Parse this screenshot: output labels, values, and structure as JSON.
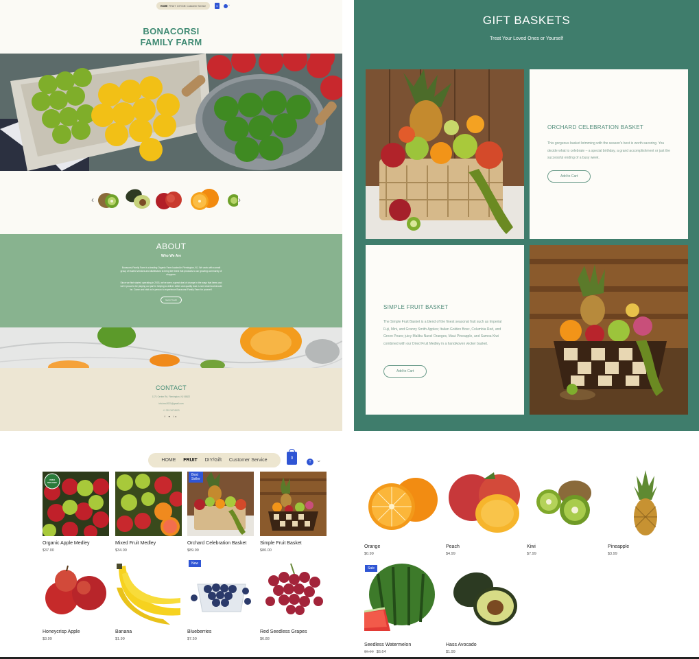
{
  "home": {
    "nav": {
      "items": [
        "HOME",
        "FRUIT",
        "DIY/Gift",
        "Customer Service"
      ],
      "active": "HOME"
    },
    "cart_count": "0",
    "brand_line1": "BONACORSI",
    "brand_line2": "FAMILY FARM",
    "about": {
      "title": "ABOUT",
      "subtitle": "Who We Are",
      "para1": "Bonacorsi Family Farm is a leading Organic Farm located in Flemington, NJ. We work with a small group of trusted vendors and distributors to bring the finest fruit products to our growing community of shoppers.",
      "para2": "Since we first started operating in 2003, we've seen a great deal of change in the ways that items and we're proud to be playing our part in helping to deliver better and quality food. Learn what food should be. Come and visit us in person to experience Bonacorsi Family Farm for yourself.",
      "button": "Get in Touch"
    },
    "contact": {
      "title": "CONTACT",
      "address": "1171 Center Rd, Flemington, NJ 08822",
      "email": "info.bnc2021@gmail.com",
      "phone": "+1 215 347 6913",
      "social": "f  ♥  in"
    }
  },
  "gifts": {
    "title": "GIFT BASKETS",
    "subtitle": "Treat Your Loved Ones or Yourself",
    "orchard": {
      "name": "ORCHARD CELEBRATION BASKET",
      "desc": "This gorgeous basket brimming with the season's best is worth savoring. You decide what to celebrate – a special birthday, a grand accomplishment or just the successful ending of a busy week.",
      "button": "Add to Cart"
    },
    "simple": {
      "name": "SIMPLE FRUIT BASKET",
      "desc": "The Simple Fruit Basket is a blend of the finest seasonal fruit such as Imperial Fuji, Mini, and Granny Smith Apples; Italian Golden Bosc, Columbia Red, and Green Pears; juicy Malibu Navel Oranges, Maui Pineapple, and Samoa Kiwi combined with our Dried Fruit Medley in a handwoven wicker basket.",
      "button": "Add to Cart"
    }
  },
  "shop": {
    "nav": {
      "items": [
        "HOME",
        "FRUIT",
        "DIY/Gift",
        "Customer Service"
      ],
      "active": "FRUIT"
    },
    "cart_count": "0",
    "avatar_letter": "T",
    "products": [
      {
        "name": "Organic Apple Medley",
        "price": "$37.00"
      },
      {
        "name": "Mixed Fruit Medley",
        "price": "$34.00"
      },
      {
        "name": "Orchard Celebration Basket",
        "price": "$89.99",
        "ribbon": "Best Seller"
      },
      {
        "name": "Simple Fruit Basket",
        "price": "$80.00"
      },
      {
        "name": "Honeycrisp Apple",
        "price": "$3.99"
      },
      {
        "name": "Banana",
        "price": "$1.99"
      },
      {
        "name": "Blueberries",
        "price": "$7.50",
        "ribbon": "New"
      },
      {
        "name": "Red Seedless Grapes",
        "price": "$6.88"
      }
    ],
    "usda_badge": "USDA ORGANIC"
  },
  "fruit": {
    "products": [
      {
        "name": "Orange",
        "price": "$0.99"
      },
      {
        "name": "Peach",
        "price": "$4.99"
      },
      {
        "name": "Kiwi",
        "price": "$7.99"
      },
      {
        "name": "Pineapple",
        "price": "$3.99"
      },
      {
        "name": "Seedless Watermelon",
        "price_old": "$6.99",
        "price": "$6.64",
        "ribbon": "Sale"
      },
      {
        "name": "Hass Avocado",
        "price": "$1.99"
      }
    ]
  },
  "colors": {
    "brand_green": "#3f8a73",
    "teal_bg": "#3f7d6c",
    "sage": "#88b38f",
    "accent_blue": "#2f55d4",
    "cream": "#ede6d3"
  }
}
